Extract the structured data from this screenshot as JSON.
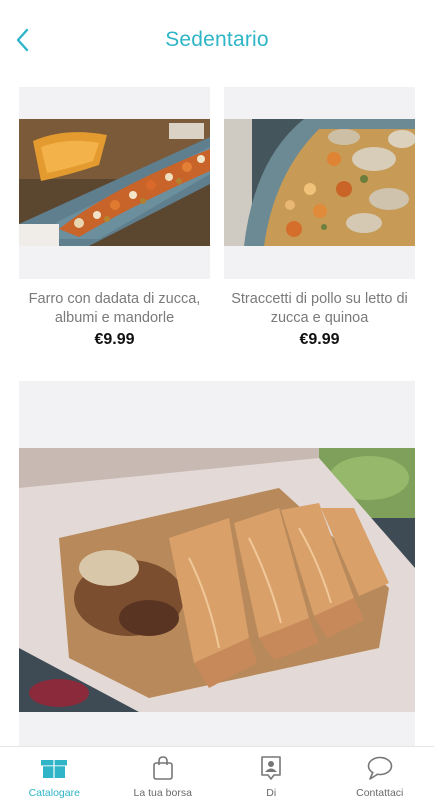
{
  "header": {
    "title": "Sedentario",
    "back_icon": "chevron-left-icon"
  },
  "accent_color": "#2fb5c7",
  "products": [
    {
      "name": "Farro con dadata di zucca, albumi e mandorle",
      "price": "€9.99"
    },
    {
      "name": "Straccetti di pollo su letto di zucca e quinoa",
      "price": "€9.99"
    }
  ],
  "tabbar": {
    "tabs": [
      {
        "label": "Catalogare",
        "icon": "gift-box-icon",
        "active": true
      },
      {
        "label": "La tua borsa",
        "icon": "shopping-bag-icon",
        "active": false
      },
      {
        "label": "Di",
        "icon": "profile-card-icon",
        "active": false
      },
      {
        "label": "Contattaci",
        "icon": "chat-bubble-icon",
        "active": false
      }
    ]
  }
}
